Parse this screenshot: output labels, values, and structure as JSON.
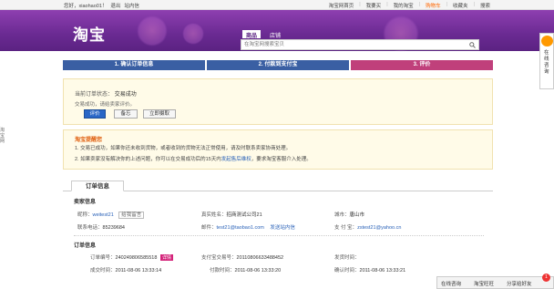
{
  "topbar": {
    "greeting": "您好，xiaohao01！",
    "logout": "退出",
    "messages": "站内信",
    "home": "淘宝网首页",
    "buy": "我要买",
    "mytaobao": "我的淘宝",
    "cart": "购物车",
    "favorites": "收藏夹",
    "search": "搜索"
  },
  "header": {
    "logo": "淘宝",
    "tab_goods": "商品",
    "tab_shop": "店铺",
    "search_placeholder": "在淘宝网搜索宝贝"
  },
  "side_float": {
    "label": "在线咨询"
  },
  "left_tab": {
    "label": "淘宝网"
  },
  "steps": [
    "1. 确认订单信息",
    "2. 付款到支付宝",
    "3. 评价"
  ],
  "status": {
    "label": "当前订单状态：",
    "value": "交易成功",
    "line2": "交易成功，请给卖家评价。",
    "buttons": [
      "评价",
      "备忘",
      "立即摄取"
    ]
  },
  "tips": {
    "title": "淘宝提醒您",
    "line1": "1. 交易已成功，如果你还未收到货物，或者收到的货物无法正常使用，请及时联系卖家协商处理。",
    "line2_pre": "2. 如果卖家没有解决你的上述问题，你可以在交易成功后的15天内",
    "line2_link": "发起售后维权",
    "line2_post": "，要求淘宝客服介入处理。"
  },
  "order": {
    "tab": "订单信息",
    "seller_section": "卖家信息",
    "nick_label": "昵称：",
    "nick_value": "weitest21",
    "chat_label": "给我留言",
    "realname_label": "真实姓名：",
    "realname_value": "招商测试公司21",
    "city_label": "城市：",
    "city_value": "唐山市",
    "phone_label": "联系电话：",
    "phone_value": "85239684",
    "email_label": "邮件：",
    "email_value": "test21@taobao1.com",
    "send_msg": "发送站内信",
    "alipay_label": "支 付 宝：",
    "alipay_value": "zstest21@yahoo.cn",
    "order_section": "订单信息",
    "order_no_label": "订单编号：",
    "order_no_value": "240249806585518",
    "order_badge": "详情",
    "alipay_tx_label": "支付宝交易号：",
    "alipay_tx_value": "20110806633488452",
    "ship_time_label": "发货时间：",
    "ship_time_value": "",
    "deal_time_label": "成交时间：",
    "deal_time_value": "2011-08-06 13:33:14",
    "pay_time_label": "付款时间：",
    "pay_time_value": "2011-08-06 13:33:20",
    "confirm_time_label": "确认时间：",
    "confirm_time_value": "2011-08-06 13:33:21"
  },
  "bottom_bar": {
    "consult": "在线咨询",
    "wangwang": "淘宝旺旺",
    "share": "分享给好友",
    "count": "1"
  }
}
